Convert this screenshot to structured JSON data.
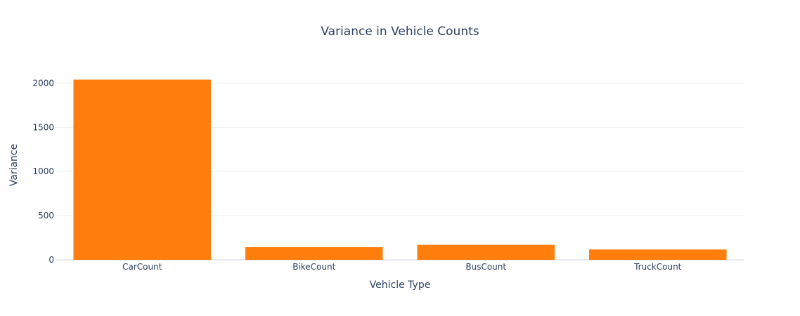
{
  "chart_data": {
    "type": "bar",
    "title": "Variance in Vehicle Counts",
    "xlabel": "Vehicle Type",
    "ylabel": "Variance",
    "categories": [
      "CarCount",
      "BikeCount",
      "BusCount",
      "TruckCount"
    ],
    "values": [
      2040,
      143,
      170,
      117
    ],
    "ylim": [
      0,
      2147
    ],
    "yticks": [
      0,
      500,
      1000,
      1500,
      2000
    ],
    "grid": true,
    "bar_color": "#ff7f0e"
  }
}
